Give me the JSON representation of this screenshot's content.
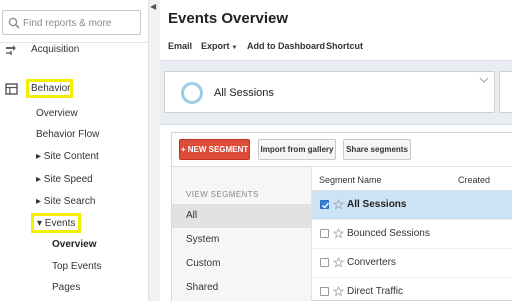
{
  "sidebar": {
    "search_placeholder": "Find reports & more",
    "acquisition": "Acquisition",
    "behavior": "Behavior",
    "behavior_items": {
      "overview": "Overview",
      "behavior_flow": "Behavior Flow",
      "site_content": "▸ Site Content",
      "site_speed": "▸ Site Speed",
      "site_search": "▸ Site Search",
      "events": "▾ Events"
    },
    "events_items": {
      "overview": "Overview",
      "top_events": "Top Events",
      "pages": "Pages"
    },
    "highlight_color": "#f5ee00"
  },
  "main": {
    "title": "Events Overview",
    "toolbar": {
      "email": "Email",
      "export": "Export",
      "add_to_dashboard": "Add to Dashboard",
      "shortcut": "Shortcut"
    },
    "segment_card": {
      "label": "All Sessions"
    },
    "panel": {
      "new_segment": "+ NEW SEGMENT",
      "import": "Import from gallery",
      "share": "Share segments",
      "view_header": "VIEW SEGMENTS",
      "views": [
        "All",
        "System",
        "Custom",
        "Shared"
      ],
      "columns": {
        "name": "Segment Name",
        "created": "Created"
      },
      "segments": [
        {
          "name": "All Sessions",
          "checked": true
        },
        {
          "name": "Bounced Sessions",
          "checked": false
        },
        {
          "name": "Converters",
          "checked": false
        },
        {
          "name": "Direct Traffic",
          "checked": false
        }
      ]
    }
  },
  "colors": {
    "accent_red": "#dd4b39",
    "selected_row": "#cbe3f4",
    "highlight": "#f5ee00"
  }
}
